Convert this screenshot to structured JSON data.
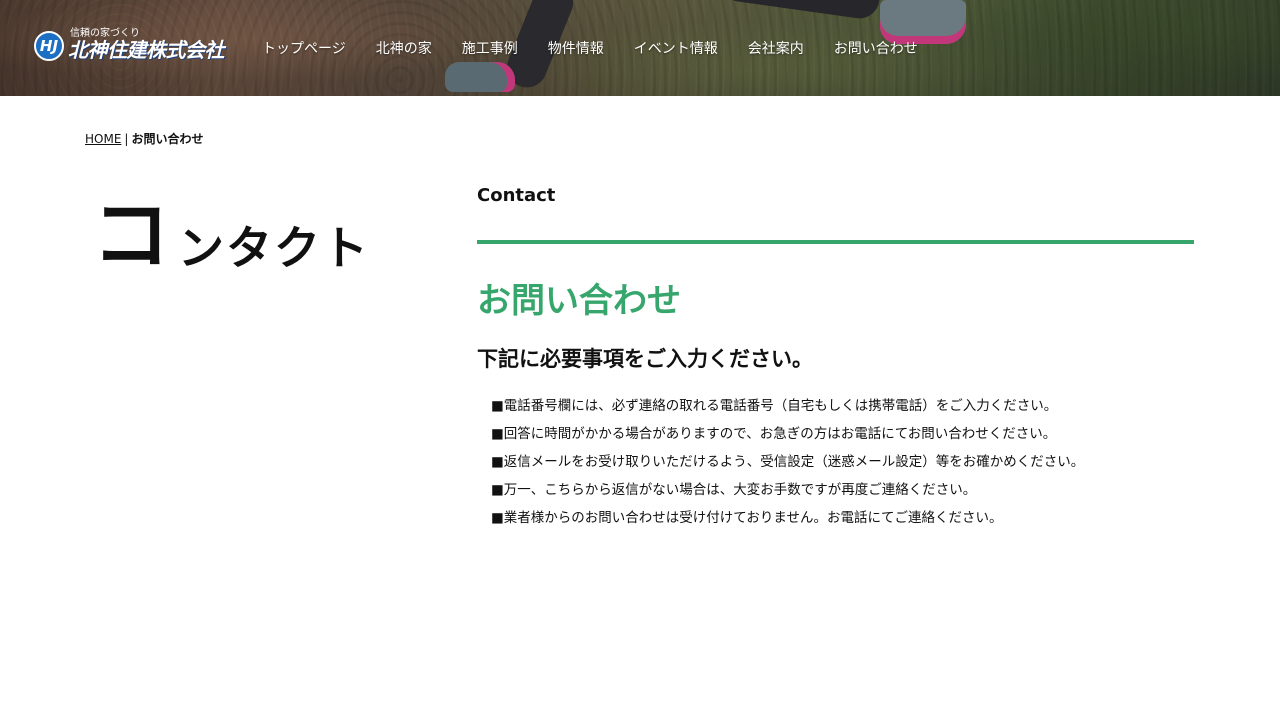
{
  "header": {
    "logo": {
      "mark": "HJ",
      "tagline": "信頼の家づくり",
      "name": "北神住建株式会社"
    },
    "nav": [
      {
        "label": "トップページ"
      },
      {
        "label": "北神の家"
      },
      {
        "label": "施工事例"
      },
      {
        "label": "物件情報"
      },
      {
        "label": "イベント情報"
      },
      {
        "label": "会社案内"
      },
      {
        "label": "お問い合わせ"
      }
    ]
  },
  "breadcrumb": {
    "home": "HOME",
    "separator": "|",
    "current": "お問い合わせ"
  },
  "page_title": {
    "first_char": "コ",
    "rest": "ンタクト"
  },
  "main": {
    "eyebrow": "Contact",
    "section_title": "お問い合わせ",
    "subheading": "下記に必要事項をご入力ください。",
    "notes": [
      "■電話番号欄には、必ず連絡の取れる電話番号（自宅もしくは携帯電話）をご入力ください。",
      "■回答に時間がかかる場合がありますので、お急ぎの方はお電話にてお問い合わせください。",
      "■返信メールをお受け取りいただけるよう、受信設定（迷惑メール設定）等をお確かめください。",
      "■万一、こちらから返信がない場合は、大変お手数ですが再度ご連絡ください。",
      "■業者様からのお問い合わせは受け付けておりません。お電話にてご連絡ください。"
    ]
  },
  "colors": {
    "accent": "#36a66c",
    "logo_blue": "#1d6fc4"
  }
}
